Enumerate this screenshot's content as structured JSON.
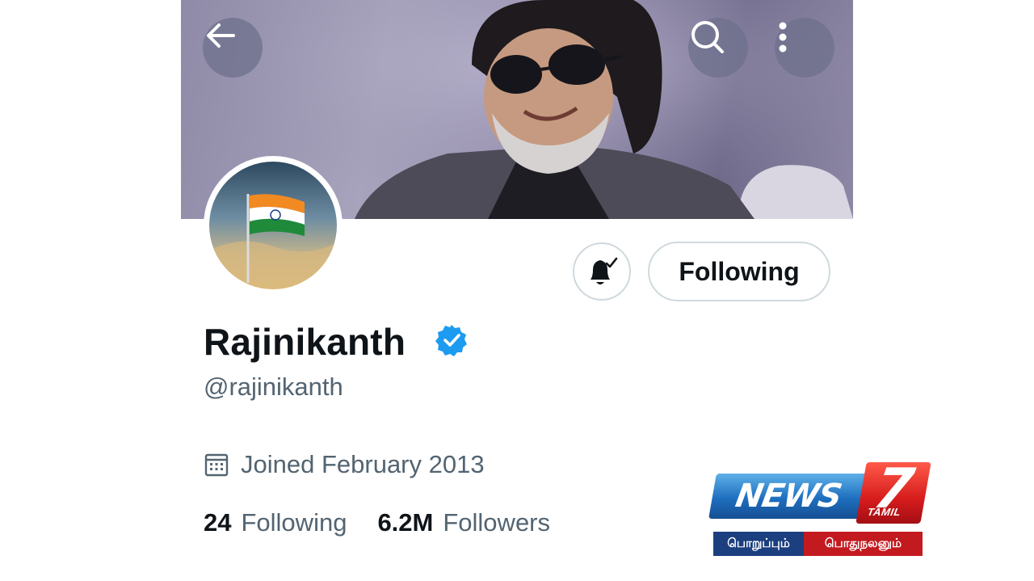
{
  "header": {
    "back_icon": "arrow-left-icon",
    "search_icon": "search-icon",
    "more_icon": "more-vertical-icon"
  },
  "profile": {
    "name": "Rajinikanth",
    "handle": "@rajinikanth",
    "verified": true,
    "joined": "Joined February 2013",
    "following_count": "24",
    "following_label": "Following",
    "followers_count": "6.2M",
    "followers_label": "Followers"
  },
  "actions": {
    "notification_icon": "bell-subscribed-icon",
    "follow_button_label": "Following"
  },
  "watermark": {
    "news_text": "NEWS",
    "seven_text": "7",
    "tamil_text": "TAMIL",
    "tagline_left": "பொறுப்பும்",
    "tagline_right": "பொதுநலனும்"
  },
  "colors": {
    "verified_blue": "#1d9bf0",
    "secondary_text": "#536471",
    "primary_text": "#0f1419",
    "border": "#cfd9de"
  }
}
